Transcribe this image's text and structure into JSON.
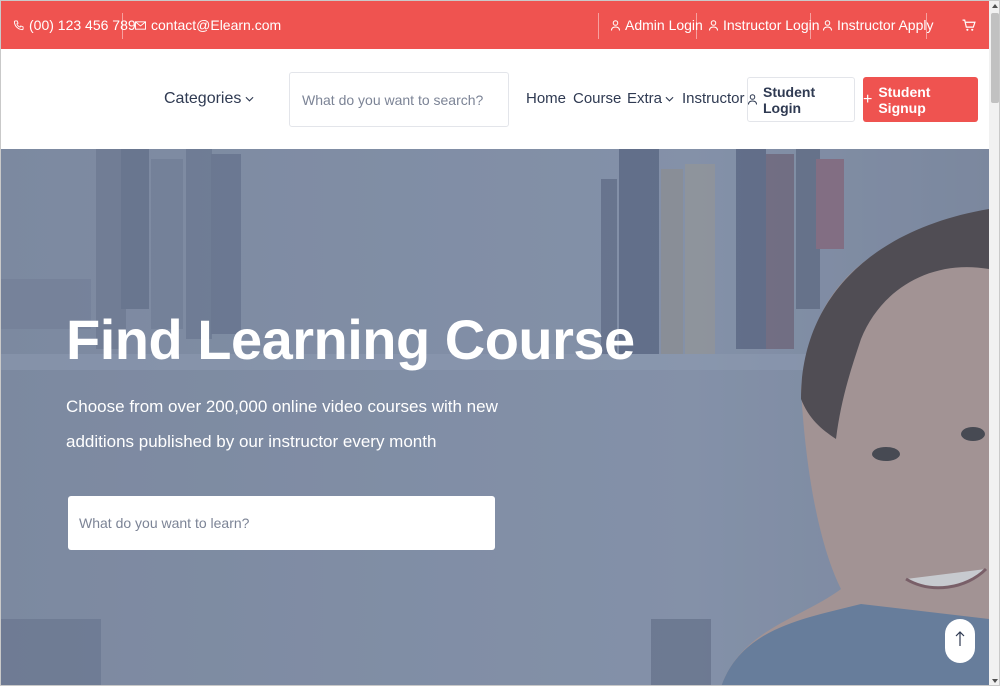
{
  "topbar": {
    "phone": "(00) 123 456 789",
    "email": "contact@Elearn.com",
    "admin_login": "Admin Login",
    "instructor_login": "Instructor Login",
    "instructor_apply": "Instructor Apply"
  },
  "nav": {
    "categories": "Categories",
    "search_placeholder": "What do you want to search?",
    "menu": [
      "Home",
      "Course",
      "Extra",
      "Instructor"
    ],
    "student_login": "Student Login",
    "student_signup": "Student Signup"
  },
  "hero": {
    "title": "Find Learning Course",
    "subtitle": "Choose from over 200,000 online video courses with new additions published by our instructor every month",
    "search_placeholder": "What do you want to learn?"
  },
  "colors": {
    "accent": "#ef5350",
    "text": "#2f3a52"
  }
}
